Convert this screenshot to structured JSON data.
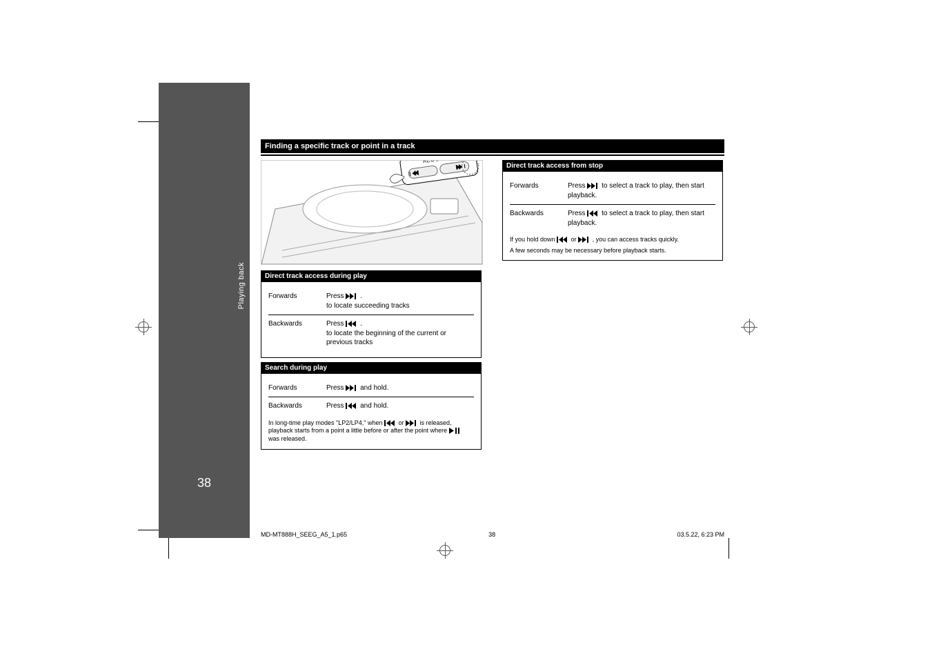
{
  "sidebar": {
    "side_label": "Playing back",
    "page_number": "38"
  },
  "heading": "Finding a specific track or point in a track",
  "sections": {
    "during_play": {
      "header": "Direct track access during play",
      "forward_dir": "Forwards",
      "forward_desc": "to locate succeeding tracks",
      "backward_dir": "Backwards",
      "backward_desc": "to locate the beginning of the current or previous tracks"
    },
    "search_play": {
      "header": "Search during play",
      "forward_dir": "Forwards",
      "forward_press": "Press ",
      "forward_tail": " and hold.",
      "backward_dir": "Backwards",
      "backward_press": "Press ",
      "backward_tail": " and hold.",
      "note_prefix": "In long-time play modes \"LP2/LP4,\" when ",
      "note_mid": " or ",
      "note_after_icons": " is released, playback starts from a point a little before or after the point where ",
      "note_end": " was released."
    },
    "from_stop": {
      "header": "Direct track access from stop",
      "forward_dir": "Forwards",
      "forward_press": "Press ",
      "forward_tail1": " to select a track to play, then start playback.",
      "backward_dir": "Backwards",
      "backward_press": "Press ",
      "backward_tail1": " to select a track to play, then start playback.",
      "note_prefix": "If you hold down ",
      "note_mid": " or ",
      "note_tail": ", you can access tracks quickly.",
      "note2": "A few seconds may be necessary before playback starts."
    }
  },
  "illustration": {
    "label": "REC LEVEL"
  },
  "footer": {
    "file": "MD-MT888H_SEEG_A5_1.p65",
    "timestamp": "03.5.22, 6:23 PM"
  },
  "registration": {
    "grayscale_steps": 11,
    "color_swatches": [
      "#ffe600",
      "#ec008c",
      "#00aeef",
      "#1a1a8a",
      "#00a651",
      "#ed1c24",
      "#000000",
      "#fff200",
      "#f49ac1",
      "#6dcff6"
    ]
  }
}
